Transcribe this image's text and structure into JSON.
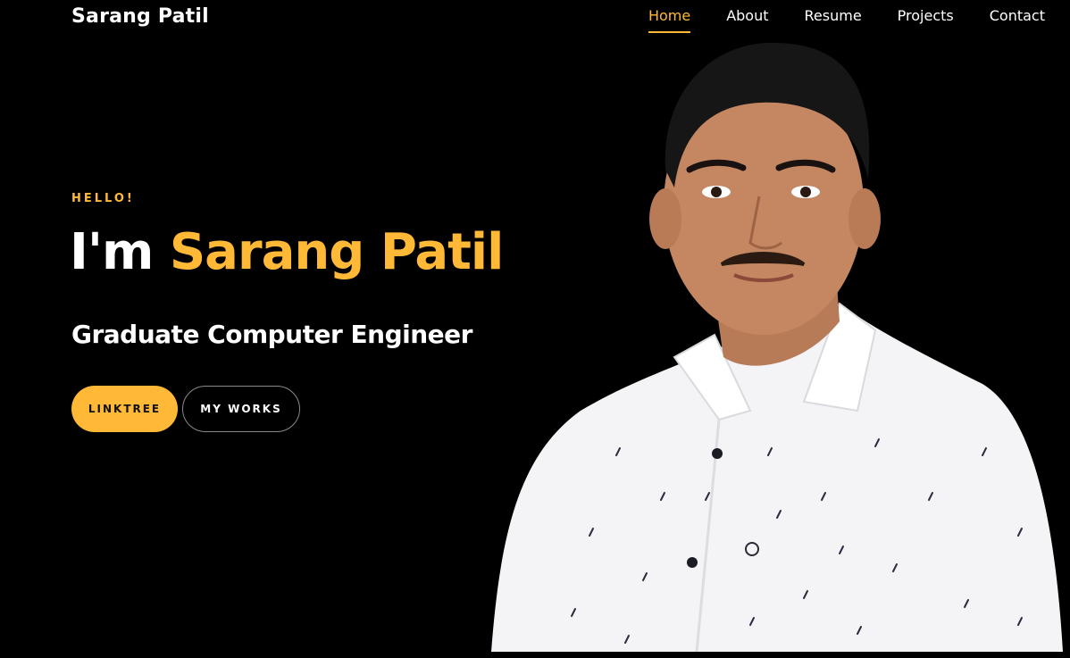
{
  "header": {
    "brand": "Sarang Patil",
    "nav": [
      {
        "label": "Home",
        "active": true
      },
      {
        "label": "About",
        "active": false
      },
      {
        "label": "Resume",
        "active": false
      },
      {
        "label": "Projects",
        "active": false
      },
      {
        "label": "Contact",
        "active": false
      }
    ]
  },
  "hero": {
    "greeting": "HELLO!",
    "intro": "I'm",
    "name": "Sarang Patil",
    "subtitle": "Graduate Computer Engineer",
    "buttons": {
      "primary": "LINKTREE",
      "secondary": "MY WORKS"
    }
  },
  "colors": {
    "accent": "#ffb936",
    "background": "#000000",
    "text": "#ffffff"
  }
}
